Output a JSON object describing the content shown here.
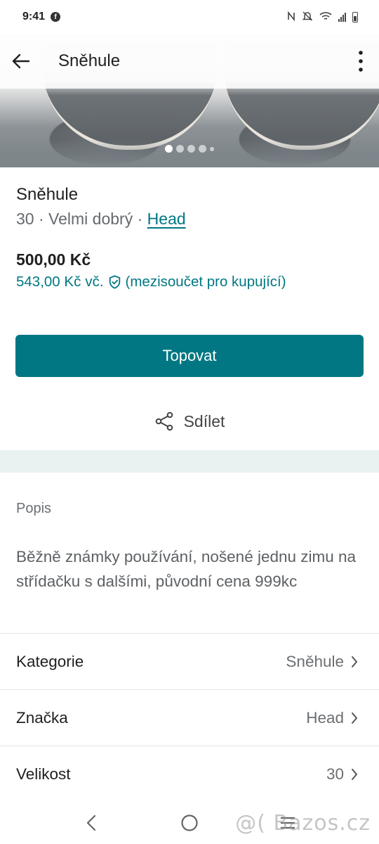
{
  "status_bar": {
    "time": "9:41",
    "fb_icon": "facebook-icon"
  },
  "top_bar": {
    "title": "Sněhule",
    "back_icon": "arrow-left-icon",
    "more_icon": "more-vertical-icon"
  },
  "gallery": {
    "total_dots": 5,
    "active_index": 0
  },
  "item": {
    "title": "Sněhule",
    "size": "30",
    "sep1": " · ",
    "condition": "Velmi dobrý",
    "sep2": " · ",
    "brand": "Head",
    "price": "500,00 Kč",
    "price_incl_amount": "543,00 Kč",
    "price_incl_suffix": "vč.",
    "price_incl_note": "(mezisoučet pro kupující)"
  },
  "actions": {
    "primary_label": "Topovat",
    "share_label": "Sdílet"
  },
  "description": {
    "label": "Popis",
    "text": "Běžně známky používání, nošené jednu zimu na střídačku s dalšími, původní cena 999kc"
  },
  "attributes": [
    {
      "key": "Kategorie",
      "value": "Sněhule"
    },
    {
      "key": "Značka",
      "value": "Head"
    },
    {
      "key": "Velikost",
      "value": "30"
    }
  ],
  "watermark": "@( Bazos.cz",
  "colors": {
    "accent": "#007782",
    "separator": "#eaf2f1"
  }
}
